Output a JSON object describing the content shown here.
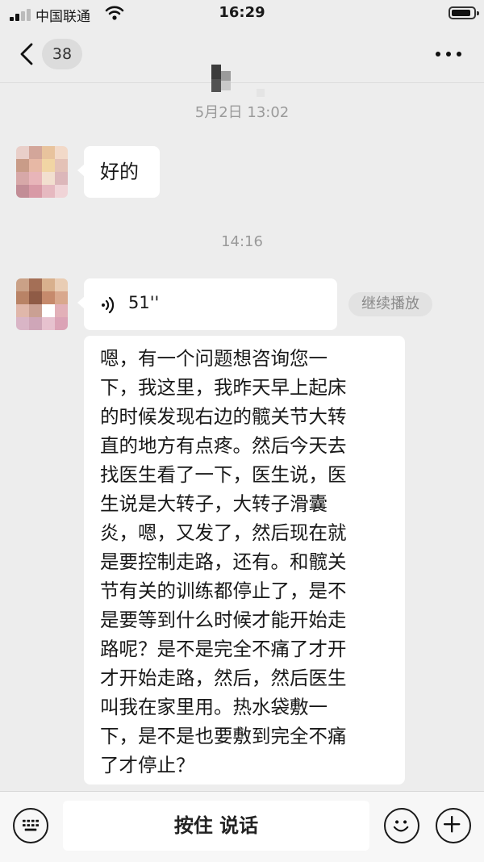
{
  "status_bar": {
    "carrier": "中国联通",
    "time": "16:29"
  },
  "nav": {
    "unread_count": "38",
    "more_label": "···"
  },
  "messages": {
    "ts1": "5月2日 13:02",
    "msg1": "好的",
    "ts2": "14:16",
    "voice_duration": "51''",
    "continue_play": "继续播放",
    "transcript_lines": [
      "嗯，有一个问题想咨询您一",
      "下，我这里，我昨天早上起床",
      "的时候发现右边的髋关节大转",
      "直的地方有点疼。然后今天去",
      "找医生看了一下，医生说，医",
      "生说是大转子，大转子滑囊",
      "炎，嗯，又发了，然后现在就",
      "是要控制走路，还有。和髋关",
      "节有关的训练都停止了，是不",
      "是要等到什么时候才能开始走",
      "路呢？是不是完全不痛了才开",
      "才开始走路，然后，然后医生",
      "叫我在家里用。热水袋敷一",
      "下，是不是也要敷到完全不痛",
      "了才停止？"
    ]
  },
  "input_bar": {
    "hold_to_talk": "按住 说话"
  },
  "icons": {
    "back": "chevron-left-icon",
    "more": "more-dots-icon",
    "keyboard": "keyboard-icon",
    "emoji": "emoji-icon",
    "add": "plus-icon",
    "voice": "voice-wave-icon"
  },
  "colors": {
    "background": "#ededed",
    "bubble": "#ffffff",
    "timestamp": "#9a9a9a"
  }
}
